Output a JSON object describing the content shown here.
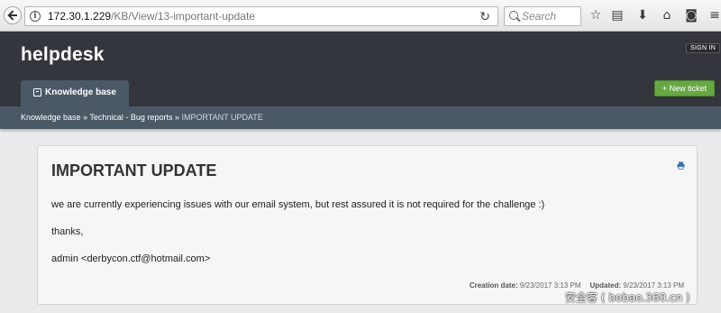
{
  "browser": {
    "url_host": "172.30.1.229",
    "url_path": "/KB/View/13-important-update",
    "search_placeholder": "Search",
    "info_glyph": "i",
    "reload_glyph": "↻",
    "icons": [
      "star-icon",
      "reading-list-icon",
      "download-icon",
      "home-icon",
      "pocket-icon",
      "menu-icon"
    ],
    "icon_glyphs": [
      "☆",
      "▤",
      "⬇",
      "⌂",
      "◙",
      "≡"
    ]
  },
  "header": {
    "brand": "helpdesk",
    "sign_in": "SIGN IN",
    "tab_label": "Knowledge base",
    "new_ticket": "+ New ticket"
  },
  "breadcrumb": {
    "items": [
      "Knowledge base",
      "Technical - Bug reports"
    ],
    "separator": " » ",
    "current": "IMPORTANT UPDATE"
  },
  "article": {
    "title": "IMPORTANT UPDATE",
    "body": [
      "we are currently experiencing issues with our email system, but rest assured it is not required for the challenge :)",
      "thanks,",
      "admin <derbycon.ctf@hotmail.com>"
    ],
    "created_label": "Creation date:",
    "created_value": "9/23/2017 3:13 PM",
    "updated_label": "Updated:",
    "updated_value": "9/23/2017 3:13 PM"
  },
  "watermark": "安全客 ( bobao.360.cn )",
  "colors": {
    "header_bg": "#33363d",
    "tab_bg": "#4b5866",
    "accent_green": "#67a843"
  }
}
